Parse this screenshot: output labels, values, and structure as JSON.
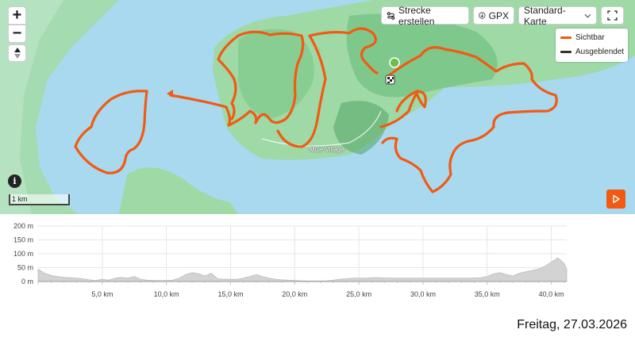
{
  "toolbar": {
    "create_route_label": "Strecke erstellen",
    "gpx_label": "GPX",
    "map_type_label": "Standard-Karte",
    "zoom_in_label": "+",
    "zoom_out_label": "−"
  },
  "legend": {
    "items": [
      {
        "label": "Sichtbar",
        "color": "#f25a12"
      },
      {
        "label": "Ausgeblendet",
        "color": "#333333"
      }
    ]
  },
  "map": {
    "place_label": "Muie Village",
    "scale_label": "1 km",
    "route_color": "#f25a12",
    "water_color": "#a9d9ef",
    "land_color": "#9ed9a6",
    "start_marker_color": "#6cc04a"
  },
  "chart_data": {
    "type": "area",
    "title": "",
    "xlabel": "",
    "ylabel": "",
    "x_unit": "km",
    "y_unit": "m",
    "xlim": [
      0,
      41.2
    ],
    "ylim": [
      0,
      200
    ],
    "x_ticks": [
      {
        "value": 5,
        "label": "5,0 km"
      },
      {
        "value": 10,
        "label": "10,0 km"
      },
      {
        "value": 15,
        "label": "15,0 km"
      },
      {
        "value": 20,
        "label": "20,0 km"
      },
      {
        "value": 25,
        "label": "25,0 km"
      },
      {
        "value": 30,
        "label": "30,0 km"
      },
      {
        "value": 35,
        "label": "35,0 km"
      },
      {
        "value": 40,
        "label": "40,0 km"
      }
    ],
    "y_ticks": [
      {
        "value": 0,
        "label": "0 m"
      },
      {
        "value": 50,
        "label": "50 m"
      },
      {
        "value": 100,
        "label": "100 m"
      },
      {
        "value": 150,
        "label": "150 m"
      },
      {
        "value": 200,
        "label": "200 m"
      }
    ],
    "x": [
      0,
      0.5,
      1,
      1.5,
      2,
      2.5,
      3,
      3.5,
      4,
      4.5,
      5,
      5.5,
      6,
      6.5,
      7,
      7.5,
      8,
      8.5,
      9,
      9.5,
      10,
      10.5,
      11,
      11.5,
      12,
      12.5,
      13,
      13.5,
      14,
      14.5,
      15,
      15.5,
      16,
      16.5,
      17,
      17.5,
      18,
      18.5,
      19,
      19.5,
      20,
      20.5,
      21,
      21.5,
      22,
      22.5,
      23,
      23.5,
      24,
      24.5,
      25,
      25.5,
      26,
      26.5,
      27,
      27.5,
      28,
      28.5,
      29,
      29.5,
      30,
      30.5,
      31,
      31.5,
      32,
      32.5,
      33,
      33.5,
      34,
      34.5,
      35,
      35.5,
      36,
      36.5,
      37,
      37.5,
      38,
      38.5,
      39,
      39.5,
      40,
      40.5,
      41,
      41.2
    ],
    "values": [
      45,
      30,
      22,
      18,
      15,
      14,
      12,
      10,
      6,
      4,
      8,
      5,
      12,
      15,
      12,
      18,
      8,
      5,
      4,
      4,
      4,
      5,
      12,
      25,
      32,
      28,
      20,
      30,
      10,
      8,
      8,
      8,
      12,
      18,
      25,
      18,
      12,
      8,
      6,
      5,
      4,
      3,
      2,
      2,
      2,
      3,
      5,
      8,
      10,
      12,
      12,
      12,
      14,
      14,
      13,
      12,
      12,
      12,
      12,
      12,
      12,
      12,
      12,
      12,
      12,
      12,
      12,
      12,
      13,
      14,
      18,
      28,
      32,
      25,
      20,
      30,
      35,
      40,
      45,
      55,
      70,
      85,
      65,
      45
    ]
  },
  "footer": {
    "date": "Freitag, 27.03.2026"
  }
}
